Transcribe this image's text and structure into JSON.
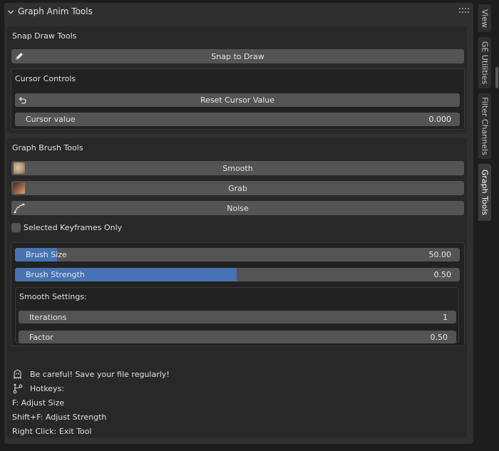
{
  "panel": {
    "title": "Graph Anim Tools"
  },
  "snap": {
    "title": "Snap Draw Tools",
    "snap_button": "Snap to Draw",
    "cursor": {
      "title": "Cursor Controls",
      "reset_button": "Reset Cursor Value",
      "field_label": "Cursor value",
      "field_value": "0.000"
    }
  },
  "brush": {
    "title": "Graph Brush Tools",
    "smooth": "Smooth",
    "grab": "Grab",
    "noise": "Noise",
    "selected_only": {
      "label": "Selected Keyframes Only",
      "checked": false
    },
    "size": {
      "label": "Brush Size",
      "value": "50.00",
      "fill_fraction": 0.095
    },
    "strength": {
      "label": "Brush Strength",
      "value": "0.50",
      "fill_fraction": 0.5
    },
    "smooth_settings": {
      "title": "Smooth Settings:",
      "iterations_label": "Iterations",
      "iterations_value": "1",
      "factor_label": "Factor",
      "factor_value": "0.50"
    }
  },
  "info": {
    "warning": "Be careful! Save your file regularly!",
    "hotkeys_title": "Hotkeys:",
    "lines": [
      "F: Adjust Size",
      "Shift+F: Adjust Strength",
      "Right Click: Exit Tool"
    ]
  },
  "tabs": [
    {
      "label": "View"
    },
    {
      "label": "GE Utilities"
    },
    {
      "label": "Filter Channels"
    },
    {
      "label": "Graph Tools"
    }
  ],
  "colors": {
    "accent": "#4772b3",
    "button": "#545454",
    "panel": "#303030"
  }
}
